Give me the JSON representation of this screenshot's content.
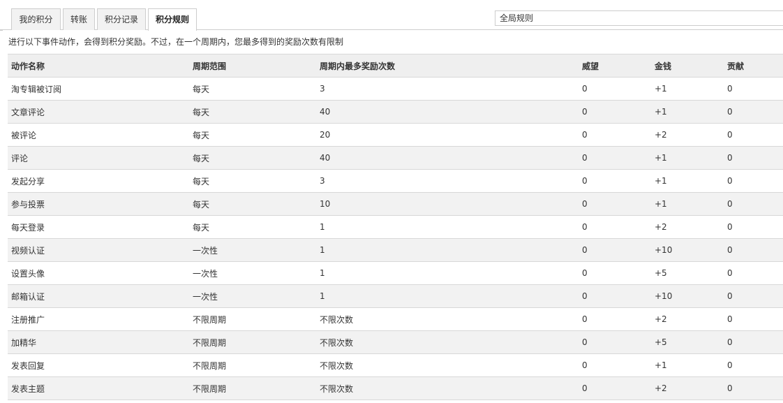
{
  "tabs": [
    {
      "label": "我的积分",
      "active": false
    },
    {
      "label": "转账",
      "active": false
    },
    {
      "label": "积分记录",
      "active": false
    },
    {
      "label": "积分规则",
      "active": true
    }
  ],
  "search": {
    "value": "全局规则"
  },
  "description": "进行以下事件动作，会得到积分奖励。不过，在一个周期内，您最多得到的奖励次数有限制",
  "table": {
    "headers": [
      "动作名称",
      "周期范围",
      "周期内最多奖励次数",
      "威望",
      "金钱",
      "贡献"
    ],
    "rows": [
      [
        "淘专辑被订阅",
        "每天",
        "3",
        "0",
        "+1",
        "0"
      ],
      [
        "文章评论",
        "每天",
        "40",
        "0",
        "+1",
        "0"
      ],
      [
        "被评论",
        "每天",
        "20",
        "0",
        "+2",
        "0"
      ],
      [
        "评论",
        "每天",
        "40",
        "0",
        "+1",
        "0"
      ],
      [
        "发起分享",
        "每天",
        "3",
        "0",
        "+1",
        "0"
      ],
      [
        "参与投票",
        "每天",
        "10",
        "0",
        "+1",
        "0"
      ],
      [
        "每天登录",
        "每天",
        "1",
        "0",
        "+2",
        "0"
      ],
      [
        "视频认证",
        "一次性",
        "1",
        "0",
        "+10",
        "0"
      ],
      [
        "设置头像",
        "一次性",
        "1",
        "0",
        "+5",
        "0"
      ],
      [
        "邮箱认证",
        "一次性",
        "1",
        "0",
        "+10",
        "0"
      ],
      [
        "注册推广",
        "不限周期",
        "不限次数",
        "0",
        "+2",
        "0"
      ],
      [
        "加精华",
        "不限周期",
        "不限次数",
        "0",
        "+5",
        "0"
      ],
      [
        "发表回复",
        "不限周期",
        "不限次数",
        "0",
        "+1",
        "0"
      ],
      [
        "发表主题",
        "不限周期",
        "不限次数",
        "0",
        "+2",
        "0"
      ]
    ]
  }
}
